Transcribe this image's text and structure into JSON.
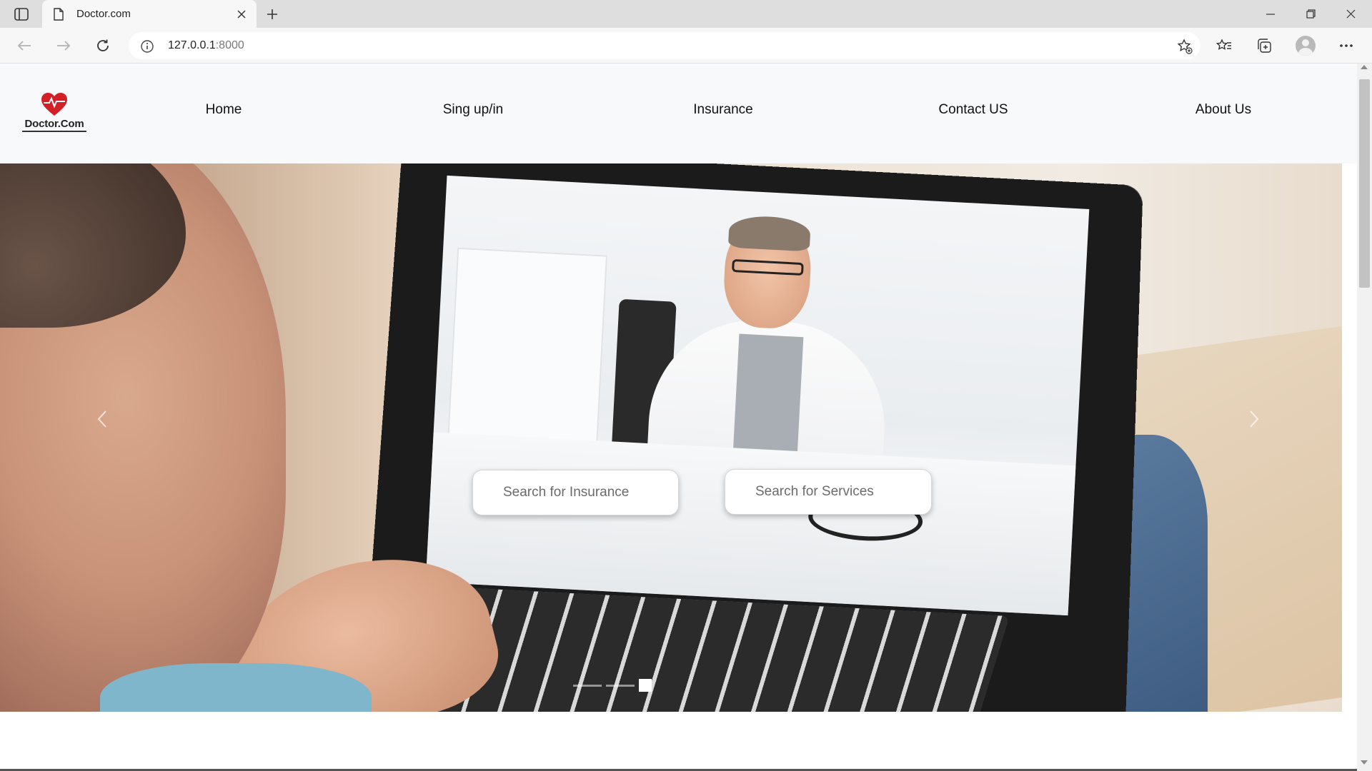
{
  "browser": {
    "tab_title": "Doctor.com",
    "url_host": "127.0.0.1",
    "url_port": ":8000",
    "icons": [
      "tab-actions-icon",
      "document-icon",
      "close-icon",
      "plus-icon",
      "minimize-icon",
      "restore-icon",
      "close-window-icon",
      "back-arrow-icon",
      "forward-arrow-icon",
      "refresh-icon",
      "info-icon",
      "add-favorite-icon",
      "favorites-icon",
      "collections-icon",
      "profile-avatar",
      "more-icon"
    ]
  },
  "site": {
    "logo_text": "Doctor.Com",
    "brand_color": "#d32027",
    "nav": [
      {
        "label": "Home"
      },
      {
        "label": "Sing up/in"
      },
      {
        "label": "Insurance"
      },
      {
        "label": "Contact US"
      },
      {
        "label": "About Us"
      }
    ]
  },
  "hero": {
    "search_insurance_placeholder": "Search for Insurance",
    "search_services_placeholder": "Search for Services",
    "prev_icon": "chevron-left-icon",
    "next_icon": "chevron-right-icon",
    "slides": 3,
    "active_slide": 3
  }
}
